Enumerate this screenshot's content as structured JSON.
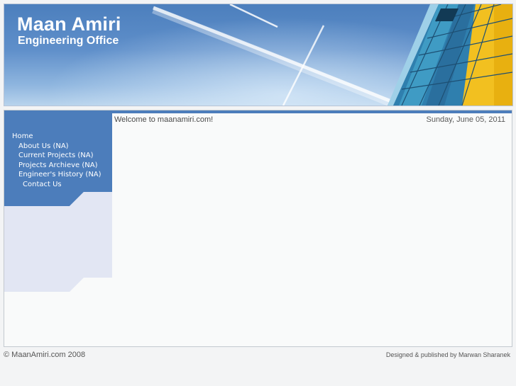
{
  "header": {
    "title": "Maan Amiri",
    "subtitle": "Engineering Office"
  },
  "sidebar": {
    "items": [
      {
        "label": "Home"
      },
      {
        "label": "About Us (NA)"
      },
      {
        "label": "Current Projects (NA)"
      },
      {
        "label": "Projects Archieve (NA)"
      },
      {
        "label": "Engineer's History (NA)"
      },
      {
        "label": "Contact Us"
      }
    ]
  },
  "main": {
    "welcome": "Welcome to maanamiri.com!",
    "date": "Sunday, June 05, 2011"
  },
  "footer": {
    "copyright": "© MaanAmiri.com 2008",
    "credits": "Designed & published by Marwan Sharanek"
  },
  "colors": {
    "brand_blue": "#4c7dbb",
    "sidebar_lower": "#e2e6f3",
    "background": "#f3f4f5"
  }
}
